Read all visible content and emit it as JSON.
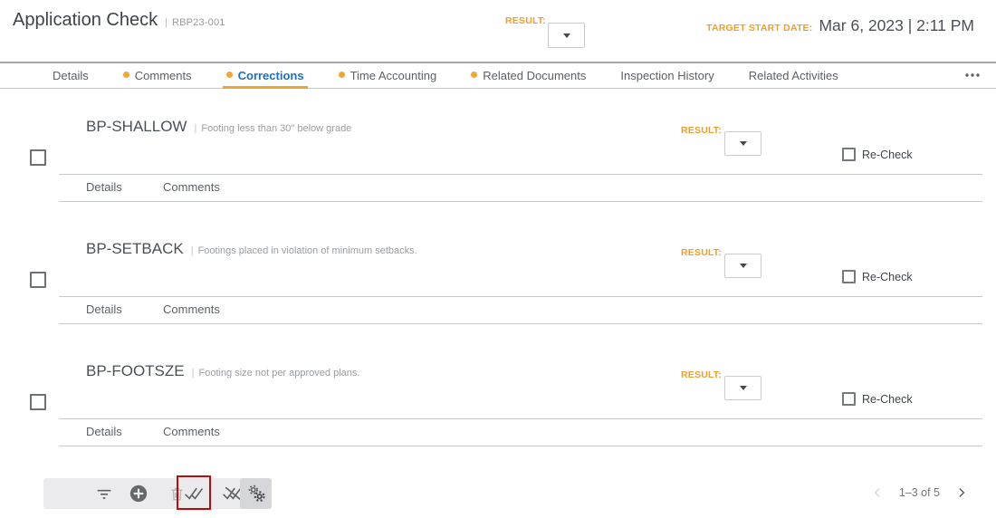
{
  "header": {
    "title": "Application Check",
    "separator": "|",
    "record_id": "RBP23-001",
    "result_label": "RESULT:",
    "target_start_label": "TARGET START DATE:",
    "target_start_value": "Mar 6, 2023 | 2:11 PM"
  },
  "tabs": [
    {
      "label": "Details",
      "dot": false,
      "active": false
    },
    {
      "label": "Comments",
      "dot": true,
      "active": false
    },
    {
      "label": "Corrections",
      "dot": true,
      "active": true
    },
    {
      "label": "Time Accounting",
      "dot": true,
      "active": false
    },
    {
      "label": "Related Documents",
      "dot": true,
      "active": false
    },
    {
      "label": "Inspection History",
      "dot": false,
      "active": false
    },
    {
      "label": "Related Activities",
      "dot": false,
      "active": false
    }
  ],
  "tabs_more_icon": "more-horizontal-icon",
  "corrections": [
    {
      "code": "BP-SHALLOW",
      "separator": "|",
      "description": "Footing less than 30\" below grade",
      "result_label": "RESULT:",
      "recheck_label": "Re-Check",
      "subtabs": [
        {
          "label": "Details"
        },
        {
          "label": "Comments"
        }
      ]
    },
    {
      "code": "BP-SETBACK",
      "separator": "|",
      "description": "Footings placed in violation of minimum setbacks.",
      "result_label": "RESULT:",
      "recheck_label": "Re-Check",
      "subtabs": [
        {
          "label": "Details"
        },
        {
          "label": "Comments"
        }
      ]
    },
    {
      "code": "BP-FOOTSZE",
      "separator": "|",
      "description": "Footing size not per approved plans.",
      "result_label": "RESULT:",
      "recheck_label": "Re-Check",
      "subtabs": [
        {
          "label": "Details"
        },
        {
          "label": "Comments"
        }
      ]
    }
  ],
  "toolbar": {
    "buttons": [
      {
        "icon": "filter-icon",
        "state": "enabled"
      },
      {
        "icon": "add-icon",
        "state": "enabled"
      },
      {
        "icon": "delete-icon",
        "state": "disabled"
      },
      {
        "icon": "approve-all-icon",
        "state": "highlighted-red-box"
      },
      {
        "icon": "unapprove-all-icon",
        "state": "enabled"
      },
      {
        "icon": "settings-gears-icon",
        "state": "selected"
      }
    ]
  },
  "pagination": {
    "prev_icon": "chevron-left-icon",
    "range_text": "1–3 of 5",
    "next_icon": "chevron-right-icon",
    "prev_enabled": false,
    "next_enabled": true
  },
  "colors": {
    "accent_orange": "#EFA12C",
    "active_tab_blue": "#1B6EC8",
    "highlight_red": "#C00A0A",
    "toolbar_bg": "#EBEBED"
  }
}
